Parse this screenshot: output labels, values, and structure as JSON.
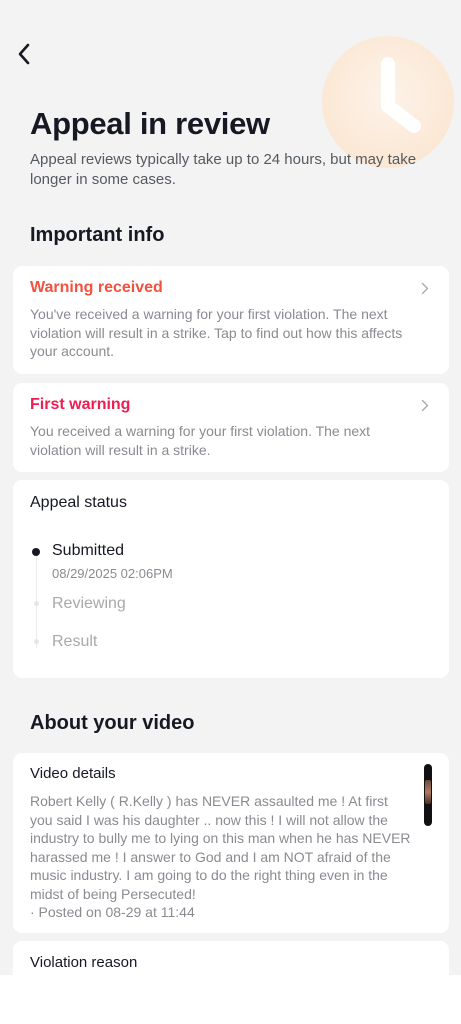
{
  "header": {
    "back_icon": "chevron-left-icon",
    "hero_icon": "clock-icon",
    "title": "Appeal in review",
    "subtitle": "Appeal reviews typically take up to 24 hours, but may take longer in some cases."
  },
  "important_info": {
    "heading": "Important info",
    "cards": [
      {
        "title": "Warning received",
        "title_color": "#f5513f",
        "body": "You've received a warning for your first violation. The next violation will result in a strike. Tap to find out how this affects your account."
      },
      {
        "title": "First warning",
        "title_color": "#ee1d52",
        "body": "You received a warning for your first violation. The next violation will result in a strike."
      }
    ]
  },
  "appeal_status": {
    "title": "Appeal status",
    "steps": [
      {
        "label": "Submitted",
        "time": "08/29/2025 02:06PM",
        "state": "done"
      },
      {
        "label": "Reviewing",
        "state": "pending"
      },
      {
        "label": "Result",
        "state": "pending"
      }
    ]
  },
  "about_video": {
    "heading": "About your video",
    "details_title": "Video details",
    "description": "Robert Kelly ( R.Kelly ) has NEVER assaulted me ! At first you said I was his daughter .. now this ! I will not allow the industry to bully me to lying on this man when he has NEVER harassed me ! I answer to God and I am NOT afraid of the music industry. I am going to do the right thing even in the midst of being Persecuted!",
    "posted": "· Posted on 08-29 at 11:44",
    "violation_title": "Violation reason"
  },
  "colors": {
    "background": "#f3f3f3",
    "card": "#ffffff",
    "warning_orange": "#f5513f",
    "warning_red": "#ee1d52",
    "muted_text": "#8a8b91",
    "hero_circle": "#fcefe2"
  }
}
